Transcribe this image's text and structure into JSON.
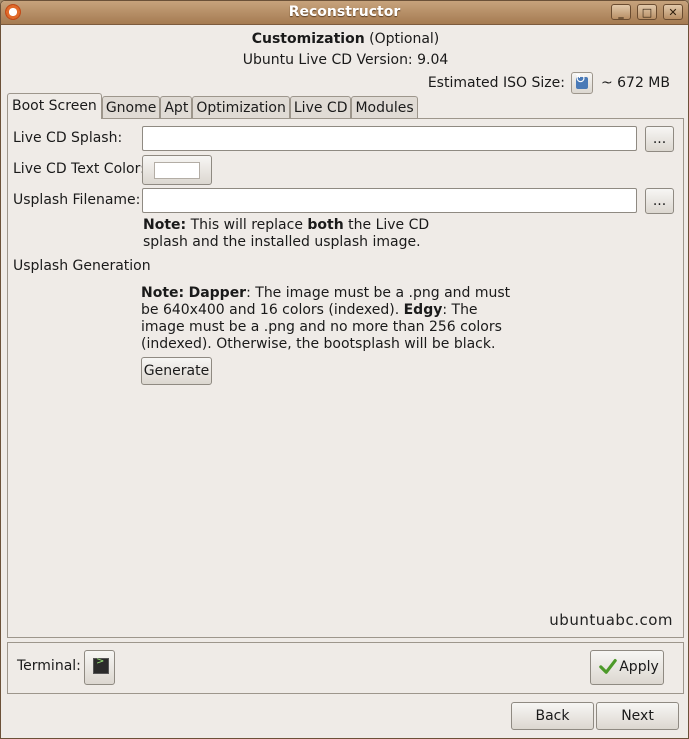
{
  "window": {
    "title": "Reconstructor",
    "colors": {
      "titlebar": "#b38a60",
      "background": "#efebe7"
    }
  },
  "titlebar_buttons": {
    "minimize": "_",
    "maximize": "□",
    "close": "✕"
  },
  "header": {
    "title_bold": "Customization",
    "title_rest": " (Optional)",
    "version": "Ubuntu Live CD Version: 9.04",
    "iso_label": "Estimated ISO Size:",
    "iso_value": "~ 672 MB"
  },
  "tabs": [
    {
      "label": "Boot Screen",
      "active": true
    },
    {
      "label": "Gnome"
    },
    {
      "label": "Apt"
    },
    {
      "label": "Optimization"
    },
    {
      "label": "Live CD"
    },
    {
      "label": "Modules"
    }
  ],
  "boot_screen": {
    "splash_label": "Live CD Splash:",
    "splash_value": "",
    "browse": "...",
    "text_color_label": "Live CD Text Color:",
    "text_color": "#ffffff",
    "usplash_label": "Usplash Filename:",
    "usplash_value": "",
    "note1": {
      "b1": "Note:",
      "t1": " This will replace ",
      "b2": "both",
      "t2": " the Live CD",
      "line2": "splash and the installed usplash image."
    },
    "generation_label": "Usplash Generation",
    "note2": {
      "b1": "Note:",
      "b2": "Dapper",
      "t1": ": The image must be a .png and must",
      "line2a": "be 640x400 and 16 colors (indexed). ",
      "b3": "Edgy",
      "line2b": ": The",
      "line3": "image must be a .png and no more than 256 colors",
      "line4": "(indexed). Otherwise, the bootsplash will be black."
    },
    "generate_button": "Generate",
    "watermark": "ubuntuabc.com"
  },
  "footer": {
    "terminal_label": "Terminal:",
    "apply_button": "Apply",
    "back_button": "Back",
    "next_button": "Next"
  }
}
